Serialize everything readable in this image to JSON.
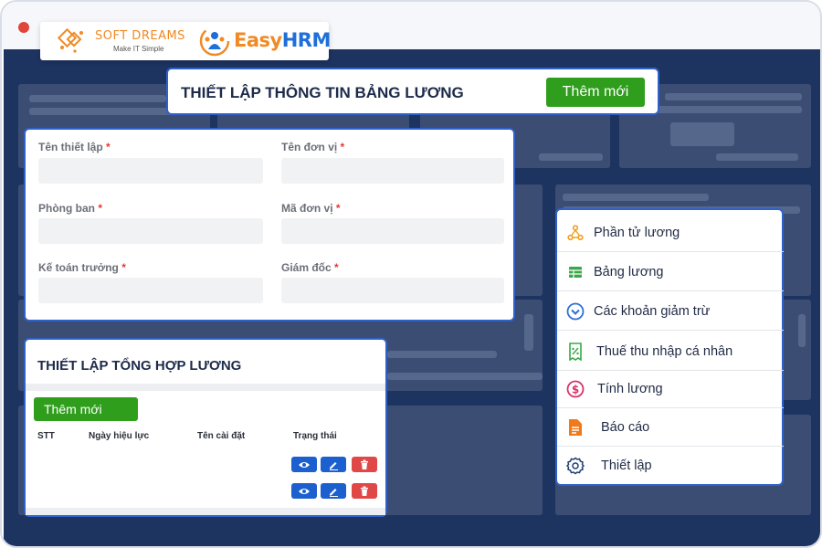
{
  "window": {
    "dots": [
      "#e0443b",
      "#f3b233",
      "#2ec24a"
    ]
  },
  "brand": {
    "softdreams_name": "SOFT DREAMS",
    "softdreams_tagline": "Make IT Simple",
    "easyhrm_prefix": "Easy",
    "easyhrm_suffix": "HRM",
    "colors": {
      "orange": "#f08a24",
      "blue": "#1e6fd9",
      "navy": "#1d3461"
    }
  },
  "salary_setup": {
    "title": "THIẾT LẬP THÔNG TIN BẢNG LƯƠNG",
    "add_label": "Thêm mới",
    "fields": [
      {
        "label": "Tên thiết lập",
        "required": "*",
        "value": ""
      },
      {
        "label": "Tên đơn vị",
        "required": "*",
        "value": ""
      },
      {
        "label": "Phòng ban",
        "required": "*",
        "value": ""
      },
      {
        "label": "Mã đơn vị",
        "required": "*",
        "value": ""
      },
      {
        "label": "Kế toán trưởng",
        "required": "*",
        "value": ""
      },
      {
        "label": "Giám đốc",
        "required": "*",
        "value": ""
      }
    ]
  },
  "summary": {
    "title": "THIẾT LẬP TỔNG HỢP LƯƠNG",
    "add_label": "Thêm mới",
    "columns": [
      "STT",
      "Ngày hiệu lực",
      "Tên cài đặt",
      "Trạng thái"
    ],
    "row_actions": [
      "eye-icon",
      "edit-icon",
      "trash-icon"
    ],
    "row_count": 2
  },
  "menu": {
    "items": [
      {
        "label": "Phần tử lương",
        "icon": "nodes-icon",
        "color": "#f0a020"
      },
      {
        "label": "Bảng lương",
        "icon": "table-icon",
        "color": "#3aa849"
      },
      {
        "label": "Các khoản giảm trừ",
        "icon": "chevron-circle-icon",
        "color": "#2f6fd6"
      },
      {
        "label": "Thuế thu nhập cá nhân",
        "icon": "receipt-icon",
        "color": "#3aa849"
      },
      {
        "label": "Tính lương",
        "icon": "dollar-circle-icon",
        "color": "#d6336c"
      },
      {
        "label": "Báo cáo",
        "icon": "document-icon",
        "color": "#f07a1a"
      },
      {
        "label": "Thiết lập",
        "icon": "gear-icon",
        "color": "#1f3f74"
      }
    ]
  }
}
